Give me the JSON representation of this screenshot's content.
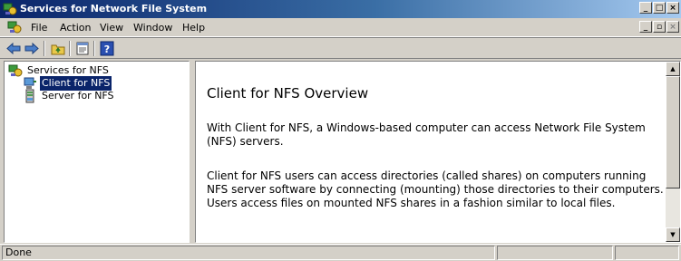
{
  "window": {
    "title": "Services for Network File System",
    "minimize": "_",
    "maximize": "□",
    "close": "×"
  },
  "menu": {
    "items": [
      "File",
      "Action",
      "View",
      "Window",
      "Help"
    ],
    "mdi_minimize": "_",
    "mdi_restore": "▫",
    "mdi_close": "×"
  },
  "toolbar": {
    "icons": [
      "back-arrow-icon",
      "forward-arrow-icon",
      "up-folder-icon",
      "properties-icon",
      "help-icon"
    ]
  },
  "tree": {
    "root": "Services for NFS",
    "children": [
      "Client for NFS",
      "Server for NFS"
    ],
    "selected": "Client for NFS"
  },
  "content": {
    "heading": "Client for NFS Overview",
    "paragraph1": "With Client for NFS, a Windows-based computer can access Network File System (NFS) servers.",
    "paragraph2": "Client for NFS users can access directories (called shares) on computers running NFS server software by connecting (mounting) those directories to their computers.  Users access files on mounted NFS shares in a fashion similar to local files."
  },
  "status": {
    "text": "Done"
  },
  "colors": {
    "title_start": "#0a246a",
    "title_end": "#a6caf0",
    "selection": "#0a246a",
    "face": "#d4d0c8"
  }
}
